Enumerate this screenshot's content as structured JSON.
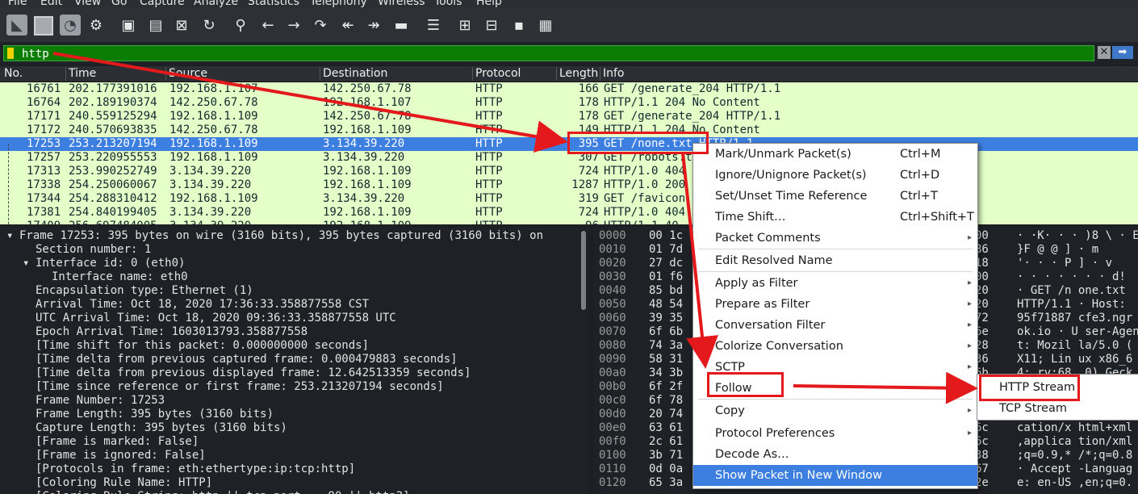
{
  "menubar": [
    "File",
    "Edit",
    "View",
    "Go",
    "Capture",
    "Analyze",
    "Statistics",
    "Telephony",
    "Wireless",
    "Tools",
    "Help"
  ],
  "filter": {
    "value": "http",
    "clear": "✕",
    "apply": "➡"
  },
  "columns": [
    "No.",
    "Time",
    "Source",
    "Destination",
    "Protocol",
    "Length",
    "Info"
  ],
  "packets": [
    {
      "no": "16761",
      "time": "202.177391016",
      "src": "192.168.1.107",
      "dst": "142.250.67.78",
      "proto": "HTTP",
      "len": "166",
      "info": "GET /generate_204 HTTP/1.1"
    },
    {
      "no": "16764",
      "time": "202.189190374",
      "src": "142.250.67.78",
      "dst": "192.168.1.107",
      "proto": "HTTP",
      "len": "178",
      "info": "HTTP/1.1 204 No Content"
    },
    {
      "no": "17171",
      "time": "240.559125294",
      "src": "192.168.1.109",
      "dst": "142.250.67.78",
      "proto": "HTTP",
      "len": "178",
      "info": "GET /generate_204 HTTP/1.1"
    },
    {
      "no": "17172",
      "time": "240.570693835",
      "src": "142.250.67.78",
      "dst": "192.168.1.109",
      "proto": "HTTP",
      "len": "149",
      "info": "HTTP/1.1 204 No Content"
    },
    {
      "no": "17253",
      "time": "253.213207194",
      "src": "192.168.1.109",
      "dst": "3.134.39.220",
      "proto": "HTTP",
      "len": "395",
      "info": "GET /none.txt HTTP/1.1",
      "selected": true
    },
    {
      "no": "17257",
      "time": "253.220955553",
      "src": "192.168.1.109",
      "dst": "3.134.39.220",
      "proto": "HTTP",
      "len": "307",
      "info": "GET /robots.txt HTTP/1.1"
    },
    {
      "no": "17313",
      "time": "253.990252749",
      "src": "3.134.39.220",
      "dst": "192.168.1.109",
      "proto": "HTTP",
      "len": "724",
      "info": "HTTP/1.0 404"
    },
    {
      "no": "17338",
      "time": "254.250060067",
      "src": "3.134.39.220",
      "dst": "192.168.1.109",
      "proto": "HTTP",
      "len": "1287",
      "info": "HTTP/1.0 200"
    },
    {
      "no": "17344",
      "time": "254.288310412",
      "src": "192.168.1.109",
      "dst": "3.134.39.220",
      "proto": "HTTP",
      "len": "319",
      "info": "GET /favicon"
    },
    {
      "no": "17381",
      "time": "254.840199405",
      "src": "3.134.39.220",
      "dst": "192.168.1.109",
      "proto": "HTTP",
      "len": "724",
      "info": "HTTP/1.0 404"
    },
    {
      "no": "17409",
      "time": "256.697484005",
      "src": "3.134.39.220",
      "dst": "192.168.1.109",
      "proto": "HTTP",
      "len": "96",
      "info": "HTTP/1.1 40"
    }
  ],
  "details": [
    {
      "indent": 0,
      "exp": "▾",
      "text": "Frame 17253: 395 bytes on wire (3160 bits), 395 bytes captured (3160 bits) on"
    },
    {
      "indent": 2,
      "exp": "",
      "text": "Section number: 1"
    },
    {
      "indent": 2,
      "exp": "▾",
      "text": "Interface id: 0 (eth0)"
    },
    {
      "indent": 4,
      "exp": "",
      "text": "Interface name: eth0"
    },
    {
      "indent": 2,
      "exp": "",
      "text": "Encapsulation type: Ethernet (1)"
    },
    {
      "indent": 2,
      "exp": "",
      "text": "Arrival Time: Oct 18, 2020 17:36:33.358877558 CST"
    },
    {
      "indent": 2,
      "exp": "",
      "text": "UTC Arrival Time: Oct 18, 2020 09:36:33.358877558 UTC"
    },
    {
      "indent": 2,
      "exp": "",
      "text": "Epoch Arrival Time: 1603013793.358877558"
    },
    {
      "indent": 2,
      "exp": "",
      "text": "[Time shift for this packet: 0.000000000 seconds]"
    },
    {
      "indent": 2,
      "exp": "",
      "text": "[Time delta from previous captured frame: 0.000479883 seconds]"
    },
    {
      "indent": 2,
      "exp": "",
      "text": "[Time delta from previous displayed frame: 12.642513359 seconds]"
    },
    {
      "indent": 2,
      "exp": "",
      "text": "[Time since reference or first frame: 253.213207194 seconds]"
    },
    {
      "indent": 2,
      "exp": "",
      "text": "Frame Number: 17253"
    },
    {
      "indent": 2,
      "exp": "",
      "text": "Frame Length: 395 bytes (3160 bits)"
    },
    {
      "indent": 2,
      "exp": "",
      "text": "Capture Length: 395 bytes (3160 bits)"
    },
    {
      "indent": 2,
      "exp": "",
      "text": "[Frame is marked: False]"
    },
    {
      "indent": 2,
      "exp": "",
      "text": "[Frame is ignored: False]"
    },
    {
      "indent": 2,
      "exp": "",
      "text": "[Protocols in frame: eth:ethertype:ip:tcp:http]"
    },
    {
      "indent": 2,
      "exp": "",
      "text": "[Coloring Rule Name: HTTP]"
    },
    {
      "indent": 2,
      "exp": "",
      "text": "[Coloring Rule String: http || tcp.port == 80 || http2]"
    }
  ],
  "bytes": [
    {
      "off": "0000",
      "hex": "00 1c",
      "hex2": "00",
      "asc": "  · ·K· · · )8 \\ · E"
    },
    {
      "off": "0010",
      "hex": "01 7d",
      "hex2": "86",
      "asc": "  }F @ @  ] · m"
    },
    {
      "off": "0020",
      "hex": "27 dc",
      "hex2": "18",
      "asc": "'· · · P ] · v"
    },
    {
      "off": "0030",
      "hex": "01 f6",
      "hex2": "00",
      "asc": "· · · · · · · d!"
    },
    {
      "off": "0040",
      "hex": "85 bd",
      "hex2": "20",
      "asc": "  · GET /n one.txt"
    },
    {
      "off": "0050",
      "hex": "48 54",
      "hex2": "20",
      "asc": "HTTP/1.1 · Host:"
    },
    {
      "off": "0060",
      "hex": "39 35",
      "hex2": "72",
      "asc": "95f71887 cfe3.ngr"
    },
    {
      "off": "0070",
      "hex": "6f 6b",
      "hex2": "6e",
      "asc": "ok.io · U ser-Agen"
    },
    {
      "off": "0080",
      "hex": "74 3a",
      "hex2": "28",
      "asc": "t: Mozil la/5.0 ("
    },
    {
      "off": "0090",
      "hex": "58 31",
      "hex2": "36",
      "asc": "X11; Lin ux x86_6"
    },
    {
      "off": "00a0",
      "hex": "34 3b",
      "hex2": "6b",
      "asc": "4; rv:68. 0) Geck"
    },
    {
      "off": "00b0",
      "hex": "6f 2f",
      "hex2": "",
      "asc": ""
    },
    {
      "off": "00c0",
      "hex": "6f 78",
      "hex2": "",
      "asc": ""
    },
    {
      "off": "00d0",
      "hex": "20 74",
      "hex2": "",
      "asc": ""
    },
    {
      "off": "00e0",
      "hex": "63 61",
      "hex2": "6c",
      "asc": "cation/x html+xml"
    },
    {
      "off": "00f0",
      "hex": "2c 61",
      "hex2": "6c",
      "asc": ",applica tion/xml"
    },
    {
      "off": "0100",
      "hex": "3b 71",
      "hex2": "38",
      "asc": ";q=0.9,* /*;q=0.8"
    },
    {
      "off": "0110",
      "hex": "0d 0a",
      "hex2": "67",
      "asc": "· Accept -Languag"
    },
    {
      "off": "0120",
      "hex": "65 3a",
      "hex2": "2e",
      "asc": "e: en-US ,en;q=0."
    }
  ],
  "context_menu": [
    {
      "label": "Mark/Unmark Packet(s)",
      "shortcut": "Ctrl+M"
    },
    {
      "label": "Ignore/Unignore Packet(s)",
      "shortcut": "Ctrl+D"
    },
    {
      "label": "Set/Unset Time Reference",
      "shortcut": "Ctrl+T"
    },
    {
      "label": "Time Shift…",
      "shortcut": "Ctrl+Shift+T"
    },
    {
      "label": "Packet Comments",
      "shortcut": "",
      "submenu": true
    },
    {
      "label": "Edit Resolved Name",
      "shortcut": ""
    },
    {
      "label": "Apply as Filter",
      "shortcut": "",
      "submenu": true
    },
    {
      "label": "Prepare as Filter",
      "shortcut": "",
      "submenu": true
    },
    {
      "label": "Conversation Filter",
      "shortcut": "",
      "submenu": true
    },
    {
      "label": "Colorize Conversation",
      "shortcut": "",
      "submenu": true
    },
    {
      "label": "SCTP",
      "shortcut": "",
      "submenu": true
    },
    {
      "label": "Follow",
      "shortcut": "",
      "submenu": true
    },
    {
      "label": "Copy",
      "shortcut": "",
      "submenu": true
    },
    {
      "label": "Protocol Preferences",
      "shortcut": "",
      "submenu": true
    },
    {
      "label": "Decode As…",
      "shortcut": ""
    },
    {
      "label": "Show Packet in New Window",
      "shortcut": "",
      "highlighted": true
    }
  ],
  "follow_submenu": [
    "HTTP Stream",
    "TCP Stream"
  ],
  "colors": {
    "accent": "#3d7fe1",
    "filter_ok": "#0b7d05",
    "row_http": "#e4ffc7",
    "annotation": "#e3191c"
  }
}
